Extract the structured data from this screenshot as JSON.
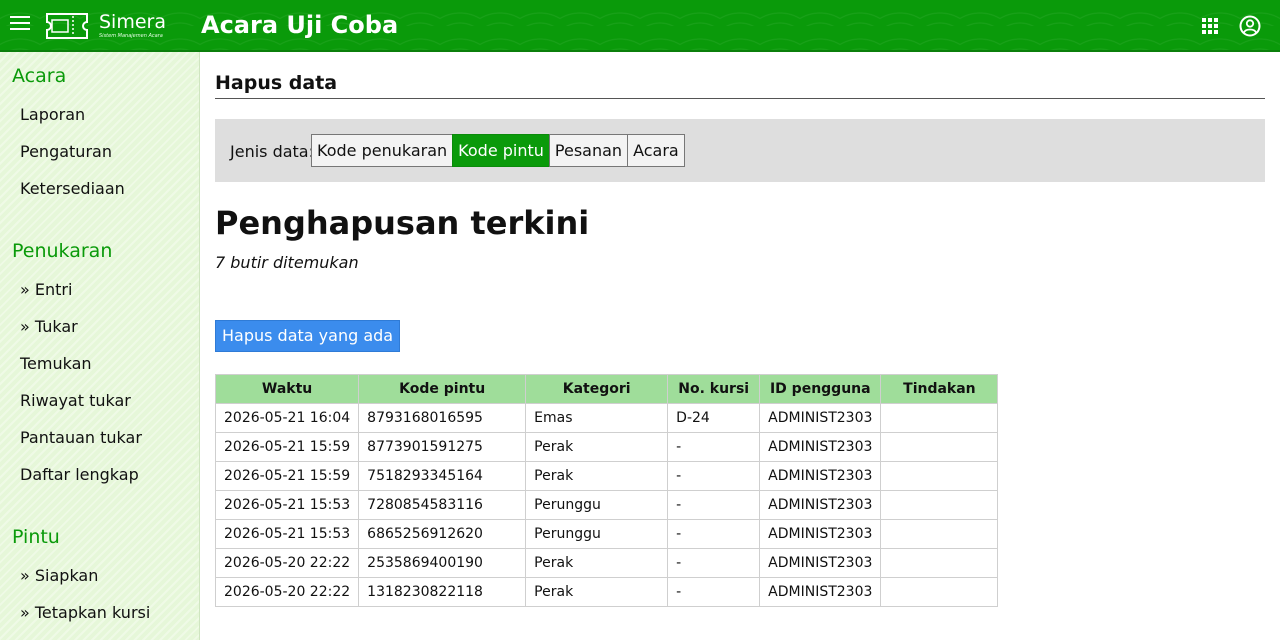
{
  "header": {
    "logo_name": "Simera",
    "logo_tagline": "Sistem Manajemen Acara",
    "title": "Acara Uji Coba",
    "icons": [
      "menu-icon",
      "apps-grid-icon",
      "user-circle-icon"
    ]
  },
  "sidebar": {
    "sections": [
      {
        "title": "Acara",
        "items": [
          "Laporan",
          "Pengaturan",
          "Ketersediaan"
        ]
      },
      {
        "title": "Penukaran",
        "items": [
          "» Entri",
          "» Tukar",
          "Temukan",
          "Riwayat tukar",
          "Pantauan tukar",
          "Daftar lengkap"
        ]
      },
      {
        "title": "Pintu",
        "items": [
          "» Siapkan",
          "» Tetapkan kursi"
        ]
      }
    ]
  },
  "main": {
    "section_title": "Hapus data",
    "filter": {
      "label": "Jenis data:",
      "options": [
        "Kode penukaran",
        "Kode pintu",
        "Pesanan",
        "Acara"
      ],
      "selected": "Kode pintu"
    },
    "heading": "Penghapusan terkini",
    "found_text": "7 butir ditemukan",
    "delete_button": "Hapus data yang ada",
    "table": {
      "columns": [
        "Waktu",
        "Kode pintu",
        "Kategori",
        "No. kursi",
        "ID pengguna",
        "Tindakan"
      ],
      "rows": [
        [
          "2026-05-21 16:04",
          "8793168016595",
          "Emas",
          "D-24",
          "ADMINIST2303",
          ""
        ],
        [
          "2026-05-21 15:59",
          "8773901591275",
          "Perak",
          "-",
          "ADMINIST2303",
          ""
        ],
        [
          "2026-05-21 15:59",
          "7518293345164",
          "Perak",
          "-",
          "ADMINIST2303",
          ""
        ],
        [
          "2026-05-21 15:53",
          "7280854583116",
          "Perunggu",
          "-",
          "ADMINIST2303",
          ""
        ],
        [
          "2026-05-21 15:53",
          "6865256912620",
          "Perunggu",
          "-",
          "ADMINIST2303",
          ""
        ],
        [
          "2026-05-20 22:22",
          "2535869400190",
          "Perak",
          "-",
          "ADMINIST2303",
          ""
        ],
        [
          "2026-05-20 22:22",
          "1318230822118",
          "Perak",
          "-",
          "ADMINIST2303",
          ""
        ]
      ]
    }
  },
  "colors": {
    "brand_green": "#0a9a0a",
    "sidebar_bg": "#e6f7d9",
    "table_header": "#9fdd9a",
    "primary_button": "#3b8ced"
  }
}
